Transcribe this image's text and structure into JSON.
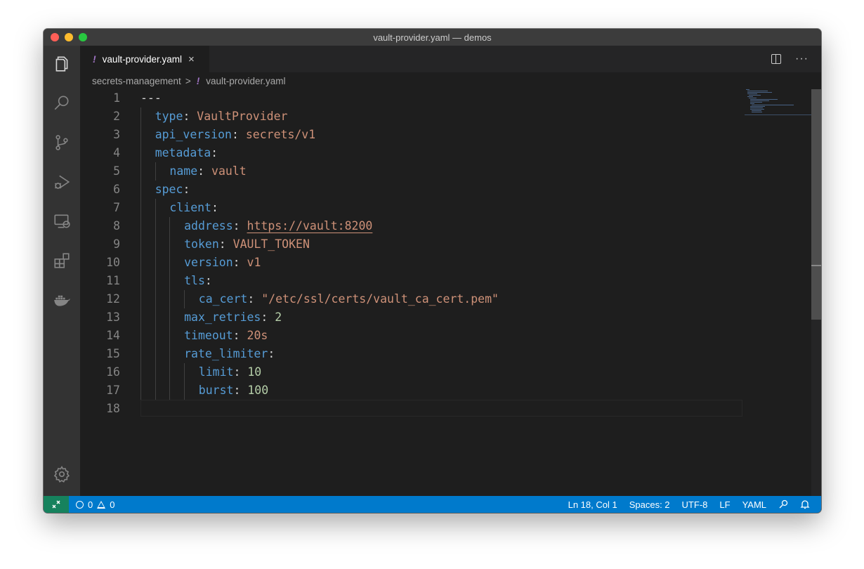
{
  "window": {
    "title": "vault-provider.yaml — demos"
  },
  "tab": {
    "icon": "!",
    "label": "vault-provider.yaml",
    "close": "×"
  },
  "breadcrumb": {
    "folder": "secrets-management",
    "separator": ">",
    "file_icon": "!",
    "file": "vault-provider.yaml"
  },
  "activity": [
    "explorer-icon",
    "search-icon",
    "source-control-icon",
    "run-debug-icon",
    "remote-explorer-icon",
    "extensions-icon",
    "docker-icon",
    "settings-gear-icon"
  ],
  "editor": {
    "line_numbers": [
      "1",
      "2",
      "3",
      "4",
      "5",
      "6",
      "7",
      "8",
      "9",
      "10",
      "11",
      "12",
      "13",
      "14",
      "15",
      "16",
      "17",
      "18"
    ],
    "lines": [
      {
        "t1": "---"
      },
      {
        "k": "type",
        "c": ":",
        "v": " VaultProvider"
      },
      {
        "k": "api_version",
        "c": ":",
        "v": " secrets/v1"
      },
      {
        "k": "metadata",
        "c": ":"
      },
      {
        "k": "name",
        "c": ":",
        "v": " vault"
      },
      {
        "k": "spec",
        "c": ":"
      },
      {
        "k": "client",
        "c": ":"
      },
      {
        "k": "address",
        "c": ":",
        "u": "https://vault:8200"
      },
      {
        "k": "token",
        "c": ":",
        "v": " VAULT_TOKEN"
      },
      {
        "k": "version",
        "c": ":",
        "v": " v1"
      },
      {
        "k": "tls",
        "c": ":"
      },
      {
        "k": "ca_cert",
        "c": ":",
        "v": " \"/etc/ssl/certs/vault_ca_cert.pem\""
      },
      {
        "k": "max_retries",
        "c": ":",
        "n": " 2"
      },
      {
        "k": "timeout",
        "c": ":",
        "v": " 20s"
      },
      {
        "k": "rate_limiter",
        "c": ":"
      },
      {
        "k": "limit",
        "c": ":",
        "n": " 10"
      },
      {
        "k": "burst",
        "c": ":",
        "n": " 100"
      }
    ]
  },
  "status": {
    "errors": "0",
    "warnings": "0",
    "position": "Ln 18, Col 1",
    "spaces": "Spaces: 2",
    "encoding": "UTF-8",
    "eol": "LF",
    "language": "YAML"
  },
  "colors": {
    "keyword": "#569cd6",
    "string": "#ce9178",
    "number": "#b5cea8",
    "statusbar": "#007acc",
    "remote": "#16825d"
  }
}
